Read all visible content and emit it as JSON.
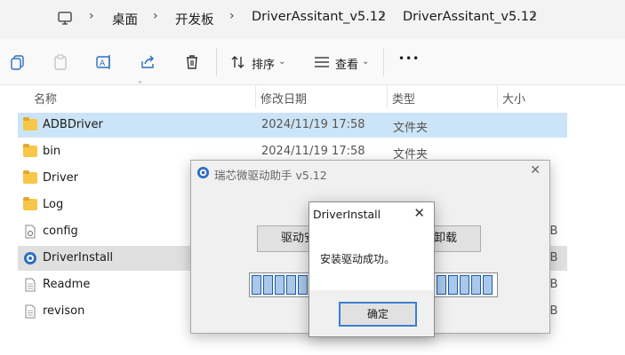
{
  "breadcrumb": {
    "items": [
      "桌面",
      "开发板",
      "DriverAssitant_v5.12",
      "DriverAssitant_v5.12"
    ],
    "icons": {
      "computer": "monitor-icon",
      "separator": "chevron-right-icon"
    }
  },
  "toolbar": {
    "sort_label": "排序",
    "view_label": "查看",
    "more_label": "•••"
  },
  "columns": {
    "name": "名称",
    "date": "修改日期",
    "type": "类型",
    "size": "大小"
  },
  "files": [
    {
      "name": "ADBDriver",
      "date": "2024/11/19 17:58",
      "type": "文件夹",
      "size": "",
      "icon": "folder-icon",
      "state": "selected"
    },
    {
      "name": "bin",
      "date": "2024/11/19 17:58",
      "type": "文件夹",
      "size": "",
      "icon": "folder-icon",
      "state": ""
    },
    {
      "name": "Driver",
      "date": "",
      "type": "",
      "size": "",
      "icon": "folder-icon",
      "state": ""
    },
    {
      "name": "Log",
      "date": "",
      "type": "",
      "size": "",
      "icon": "folder-icon",
      "state": ""
    },
    {
      "name": "config",
      "date": "",
      "type": "",
      "size": "KB",
      "icon": "config-file-icon",
      "state": ""
    },
    {
      "name": "DriverInstall",
      "date": "",
      "type": "",
      "size": "KB",
      "icon": "app-icon",
      "state": "hover"
    },
    {
      "name": "Readme",
      "date": "",
      "type": "",
      "size": "KB",
      "icon": "text-file-icon",
      "state": ""
    },
    {
      "name": "revison",
      "date": "",
      "type": "",
      "size": "KB",
      "icon": "text-file-icon",
      "state": ""
    }
  ],
  "main_dialog": {
    "title": "瑞芯微驱动助手 v5.12",
    "install_button_partial": "驱动安",
    "uninstall_button_partial": "卸载",
    "close": "✕"
  },
  "message_box": {
    "title": "DriverInstall",
    "message": "安装驱动成功。",
    "ok_label": "确定",
    "close": "✕"
  },
  "colors": {
    "selected_row": "#cce4f7",
    "progress_fill": "#aac9ea",
    "accent": "#3c7fd1"
  }
}
